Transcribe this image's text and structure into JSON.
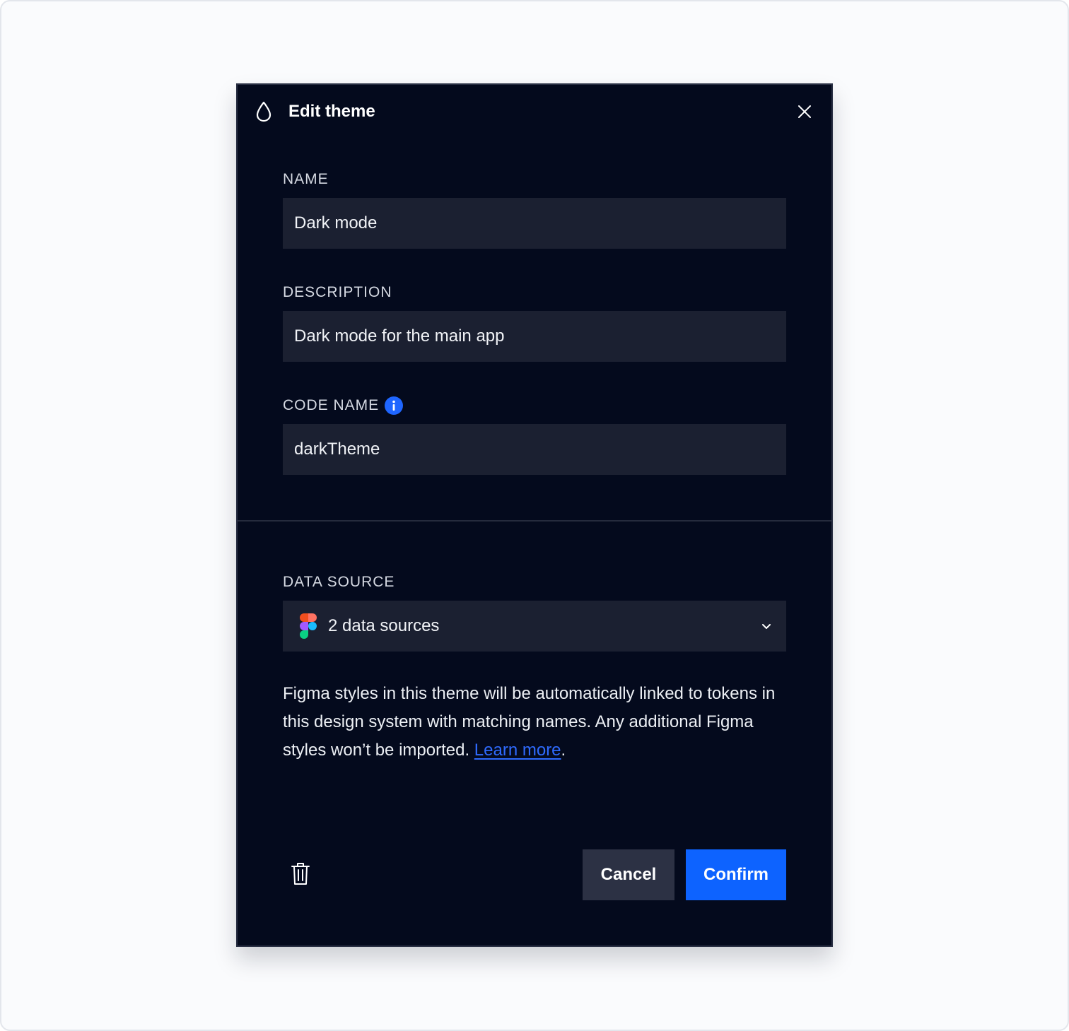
{
  "modal": {
    "title": "Edit theme",
    "title_icon": "drop-icon",
    "close_icon": "close-icon"
  },
  "fields": {
    "name": {
      "label": "NAME",
      "value": "Dark mode"
    },
    "description": {
      "label": "DESCRIPTION",
      "value": "Dark mode for the main app"
    },
    "code_name": {
      "label": "CODE NAME",
      "value": "darkTheme",
      "info_icon": "info-icon"
    }
  },
  "data_source": {
    "label": "DATA SOURCE",
    "selected": "2 data sources",
    "icon": "figma-icon"
  },
  "helper": {
    "text": "Figma styles in this theme will be automatically linked to tokens in this design system with matching names. Any additional Figma styles won’t be imported. ",
    "link_text": "Learn more",
    "suffix": "."
  },
  "footer": {
    "delete_icon": "trash-icon",
    "cancel_label": "Cancel",
    "confirm_label": "Confirm"
  },
  "colors": {
    "modal_bg": "#040a1d",
    "input_bg": "#1b2031",
    "accent": "#0d63ff",
    "link": "#2f6bff",
    "info": "#1f66ff",
    "cancel_bg": "#2c3144"
  }
}
